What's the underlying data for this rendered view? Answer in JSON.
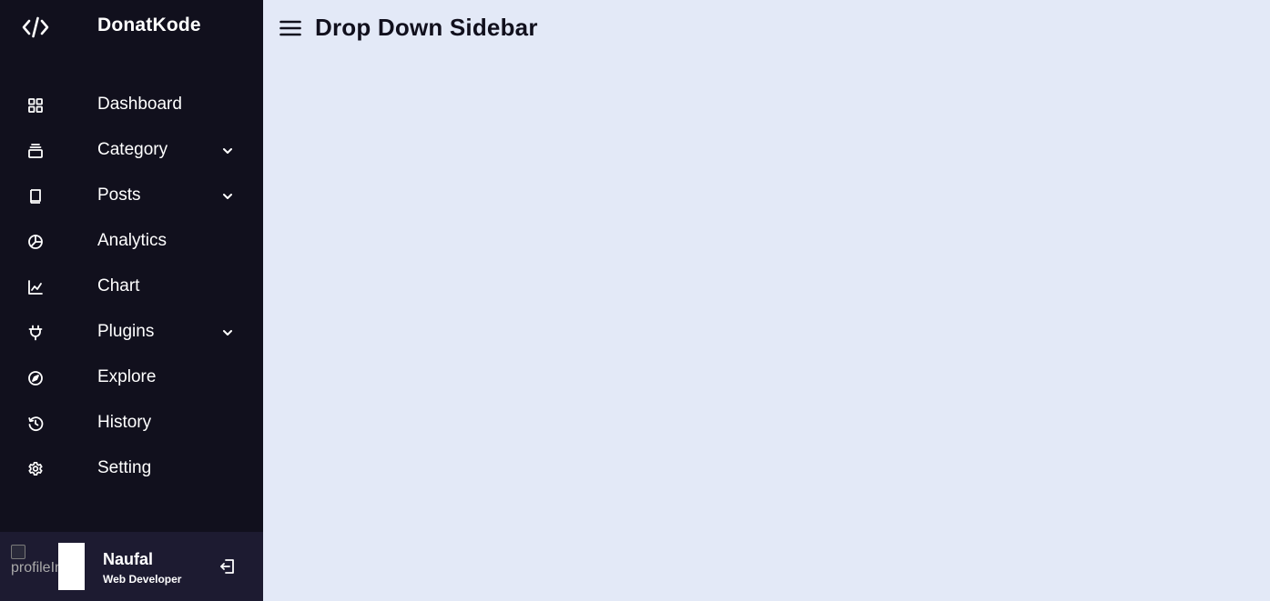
{
  "brand": {
    "name": "DonatKode",
    "icon": "code-icon"
  },
  "sidebar": {
    "items": [
      {
        "label": "Dashboard",
        "icon": "grid-icon",
        "has_submenu": false
      },
      {
        "label": "Category",
        "icon": "collection-icon",
        "has_submenu": true
      },
      {
        "label": "Posts",
        "icon": "book-icon",
        "has_submenu": true
      },
      {
        "label": "Analytics",
        "icon": "pie-chart-icon",
        "has_submenu": false
      },
      {
        "label": "Chart",
        "icon": "line-chart-icon",
        "has_submenu": false
      },
      {
        "label": "Plugins",
        "icon": "plug-icon",
        "has_submenu": true
      },
      {
        "label": "Explore",
        "icon": "compass-icon",
        "has_submenu": false
      },
      {
        "label": "History",
        "icon": "history-icon",
        "has_submenu": false
      },
      {
        "label": "Setting",
        "icon": "gear-icon",
        "has_submenu": false
      }
    ]
  },
  "profile": {
    "avatar_alt": "profileImg",
    "name": "Naufal",
    "job": "Web Developer",
    "logout_icon": "logout-icon"
  },
  "header": {
    "title": "Drop Down Sidebar",
    "menu_icon": "hamburger-menu-icon"
  },
  "colors": {
    "sidebar_bg": "#11101d",
    "profile_bg": "#1d1b31",
    "content_bg": "#e3e9f7",
    "text_light": "#ffffff",
    "text_dark": "#11101d"
  }
}
